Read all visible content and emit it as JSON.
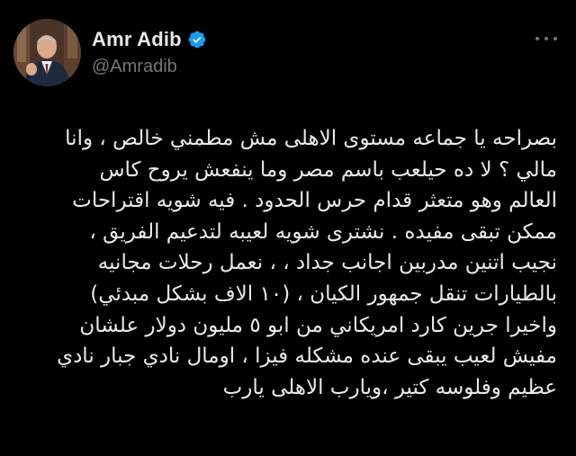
{
  "author": {
    "display_name": "Amr Adib",
    "handle": "@Amradib",
    "verified": true,
    "avatar": "profile-photo"
  },
  "tweet": {
    "lines": [
      "بصراحه يا جماعه مستوى الاهلى مش مطمني خالص ، وانا",
      "مالي ؟ لا ده حيلعب باسم مصر وما ينفعش يروح كاس",
      "العالم وهو متعثر قدام حرس الحدود . فيه شويه اقتراحات",
      "ممكن تبقى مفيده . نشترى شويه لعيبه لتدعيم الفريق ،",
      "نجيب اتنين مدربين اجانب جداد ، ، نعمل رحلات مجانيه",
      "بالطيارات تنقل جمهور الكيان ، (١٠ الاف بشكل مبدئي)",
      "واخيرا جرين كارد امريكاني من ابو ٥ مليون دولار علشان",
      "مفيش لعيب يبقى عنده مشكله فيزا ، اومال نادي جبار نادي",
      "عظيم وفلوسه كتير ،ويارب الاهلى يارب"
    ]
  },
  "colors": {
    "background": "#000000",
    "text": "#e7e9ea",
    "secondary": "#71767b",
    "verified_badge": "#1d9bf0"
  },
  "icons": {
    "verified": "verified-badge-icon",
    "more": "more-options-icon"
  }
}
